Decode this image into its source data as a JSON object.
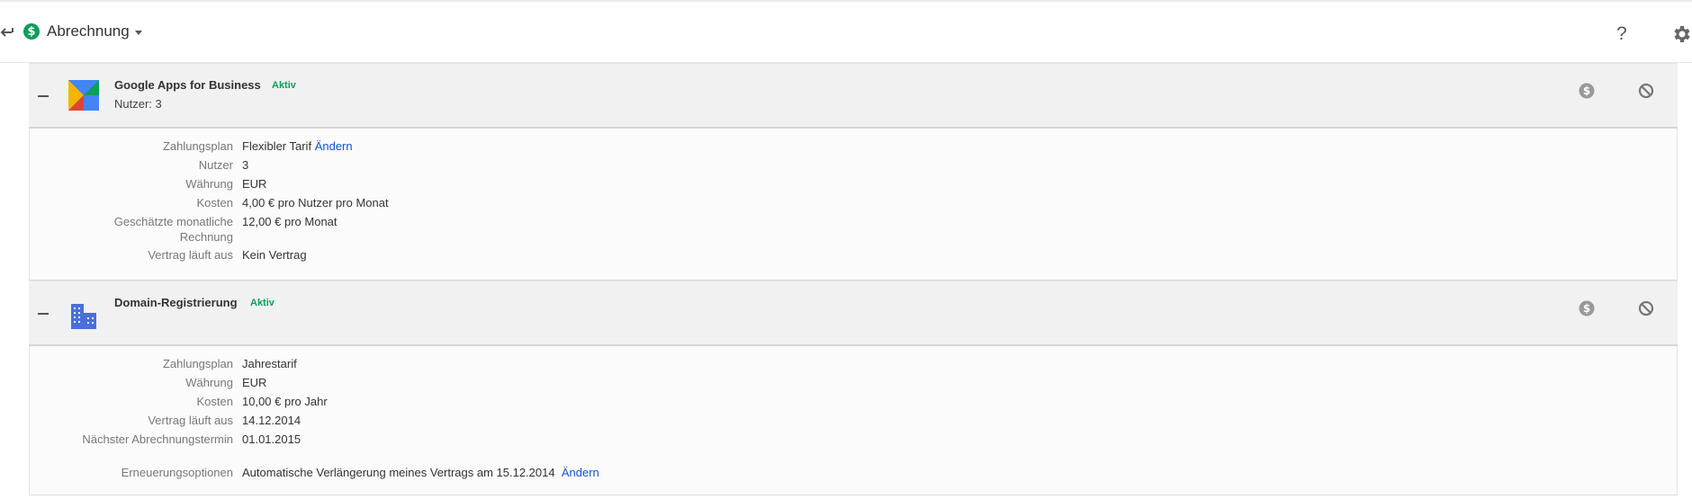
{
  "header": {
    "title": "Abrechnung",
    "dollar_symbol": "$",
    "help_symbol": "?"
  },
  "products": [
    {
      "name": "Google Apps for Business",
      "status": "Aktiv",
      "users_line": "Nutzer: 3",
      "details": [
        {
          "label": "Zahlungsplan",
          "value": "Flexibler Tarif",
          "link": "Ändern"
        },
        {
          "label": "Nutzer",
          "value": "3"
        },
        {
          "label": "Währung",
          "value": "EUR"
        },
        {
          "label": "Kosten",
          "value": "4,00 € pro Nutzer pro Monat"
        },
        {
          "label": "Geschätzte monatliche Rechnung",
          "value": "12,00 € pro Monat"
        },
        {
          "label": "Vertrag läuft aus",
          "value": "Kein Vertrag"
        }
      ]
    },
    {
      "name": "Domain-Registrierung",
      "status": "Aktiv",
      "details": [
        {
          "label": "Zahlungsplan",
          "value": "Jahrestarif"
        },
        {
          "label": "Währung",
          "value": "EUR"
        },
        {
          "label": "Kosten",
          "value": "10,00 € pro Jahr"
        },
        {
          "label": "Vertrag läuft aus",
          "value": "14.12.2014"
        },
        {
          "label": "Nächster Abrechnungstermin",
          "value": "01.01.2015"
        },
        {
          "label": "Erneuerungsoptionen",
          "value": "Automatische Verlängerung meines Vertrags am 15.12.2014",
          "link": "Ändern"
        }
      ]
    }
  ],
  "colors": {
    "accent_green": "#0f9d58",
    "link_blue": "#1155cc",
    "header_bg": "#f1f1f1"
  },
  "icons": {
    "back": "arrow-back-icon",
    "billing": "dollar-circle-icon",
    "help": "help-icon",
    "settings": "gear-icon",
    "product1": "google-apps-icon",
    "product2": "domain-building-icon",
    "billing_action": "dollar-action-icon",
    "cancel_action": "cancel-icon"
  }
}
